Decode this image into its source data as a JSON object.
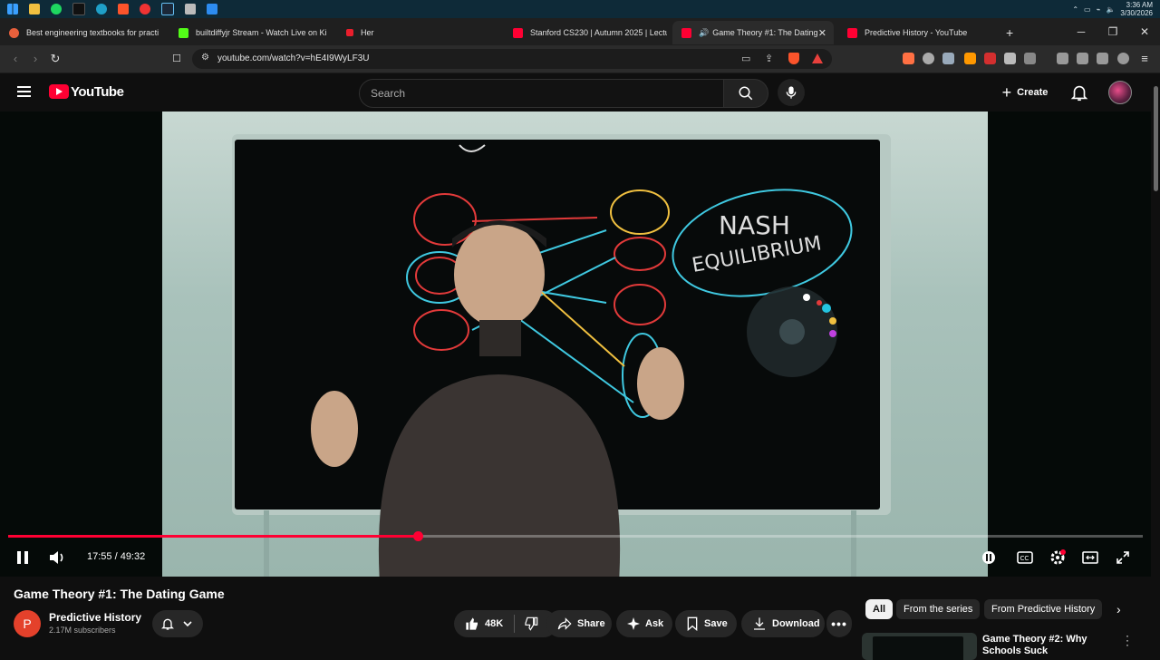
{
  "taskbar": {
    "clock_time": "3:36 AM",
    "clock_date": "3/30/2026",
    "icons": [
      "windows-start-icon",
      "file-explorer-icon",
      "spotify-icon",
      "tiktok-icon",
      "edge-icon",
      "brave-icon",
      "chrome-icon",
      "steam-icon",
      "app-icon",
      "app-icon-2"
    ]
  },
  "tabs": [
    {
      "title": "Best engineering textbooks for practi",
      "active": false
    },
    {
      "title": "builtdiffyjr Stream - Watch Live on Ki",
      "active": false
    },
    {
      "title": "Her",
      "active": false
    },
    {
      "title": "Stanford CS230 | Autumn 2025 | Lectu",
      "active": false
    },
    {
      "title": "Game Theory #1: The Dating Game",
      "active": true
    },
    {
      "title": "Predictive History - YouTube",
      "active": false
    }
  ],
  "address_bar": {
    "url": "youtube.com/watch?v=hE4I9WyLF3U"
  },
  "header": {
    "logo_text": "YouTube",
    "search_placeholder": "Search",
    "create_label": "Create"
  },
  "player": {
    "current_time": "17:55",
    "duration": "49:32",
    "time_display": "17:55 / 49:32",
    "progress_fraction": 0.361,
    "board_text": [
      "NASH",
      "EQUILIBRIUM"
    ]
  },
  "video": {
    "title": "Game Theory #1: The Dating Game",
    "channel_name": "Predictive History",
    "channel_initial": "P",
    "subscribers": "2.17M subscribers",
    "likes": "48K",
    "share_label": "Share",
    "ask_label": "Ask",
    "save_label": "Save",
    "download_label": "Download"
  },
  "sidebar": {
    "chips": [
      "All",
      "From the series",
      "From Predictive History"
    ],
    "recommendation": {
      "title": "Game Theory #2:  Why Schools Suck"
    }
  },
  "colors": {
    "accent": "#ff0033",
    "background": "#0f0f0f"
  }
}
